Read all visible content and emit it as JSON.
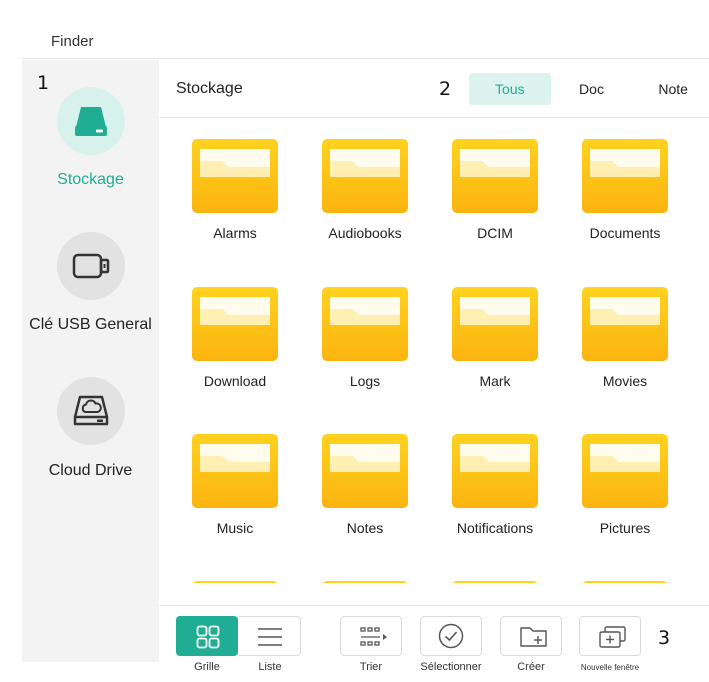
{
  "window": {
    "title": "Finder"
  },
  "callouts": [
    "1",
    "2",
    "3"
  ],
  "sidebar": {
    "items": [
      {
        "label": "Stockage",
        "icon": "storage-drive-icon",
        "active": true
      },
      {
        "label": "Clé USB General",
        "icon": "usb-drive-icon",
        "active": false
      },
      {
        "label": "Cloud Drive",
        "icon": "cloud-drive-icon",
        "active": false
      }
    ]
  },
  "main": {
    "section_title": "Stockage",
    "tabs": [
      {
        "label": "Tous",
        "active": true
      },
      {
        "label": "Doc",
        "active": false
      },
      {
        "label": "Note",
        "active": false
      }
    ],
    "folders": [
      "Alarms",
      "Audiobooks",
      "DCIM",
      "Documents",
      "Download",
      "Logs",
      "Mark",
      "Movies",
      "Music",
      "Notes",
      "Notifications",
      "Pictures"
    ]
  },
  "toolbar": {
    "items": [
      {
        "label": "Grille",
        "icon": "grid-view-icon",
        "active": true
      },
      {
        "label": "Liste",
        "icon": "list-view-icon",
        "active": false
      },
      {
        "label": "Trier",
        "icon": "sort-icon",
        "active": false
      },
      {
        "label": "Sélectionner",
        "icon": "select-check-icon",
        "active": false
      },
      {
        "label": "Créer",
        "icon": "new-folder-icon",
        "active": false
      },
      {
        "label": "Nouvelle fenêtre",
        "icon": "new-window-icon",
        "active": false
      }
    ]
  },
  "colors": {
    "accent": "#1fae93",
    "accent_light": "#dcf3ef",
    "folder_top": "#ffd21f",
    "folder_bottom": "#fbb40f"
  }
}
